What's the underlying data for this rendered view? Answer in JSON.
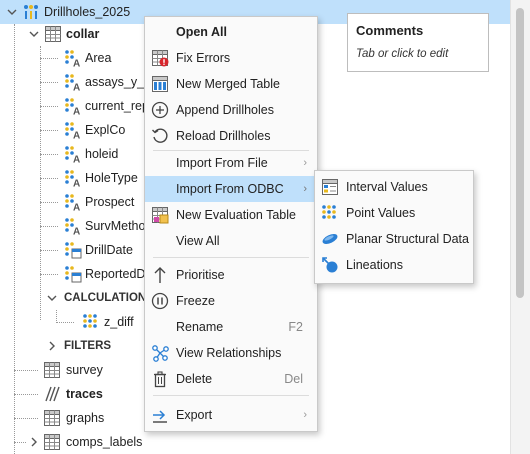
{
  "tree": {
    "root": {
      "label": "Drillholes_2025",
      "icon": "drillholes-icon"
    },
    "collar": {
      "label": "collar",
      "icon": "table-icon"
    },
    "collar_columns": [
      {
        "label": "Area",
        "icon": "text-column-icon"
      },
      {
        "label": "assays_y_n",
        "icon": "text-column-icon"
      },
      {
        "label": "current_rep",
        "icon": "text-column-icon"
      },
      {
        "label": "ExplCo",
        "icon": "text-column-icon"
      },
      {
        "label": "holeid",
        "icon": "text-column-icon"
      },
      {
        "label": "HoleType",
        "icon": "text-column-icon"
      },
      {
        "label": "Prospect",
        "icon": "text-column-icon"
      },
      {
        "label": "SurvMetho",
        "icon": "text-column-icon"
      },
      {
        "label": "DrillDate",
        "icon": "date-column-icon"
      },
      {
        "label": "ReportedDa",
        "icon": "date-column-icon"
      }
    ],
    "calculations": {
      "label": "CALCULATIONS"
    },
    "calc_column": {
      "label": "z_diff",
      "icon": "numeric-column-icon"
    },
    "filters": {
      "label": "FILTERS"
    },
    "survey": {
      "label": "survey",
      "icon": "table-icon"
    },
    "traces": {
      "label": "traces",
      "icon": "traces-icon"
    },
    "graphs": {
      "label": "graphs",
      "icon": "table-icon"
    },
    "comps_labels": {
      "label": "comps_labels",
      "icon": "table-icon"
    }
  },
  "comments": {
    "title": "Comments",
    "hint": "Tab or click to edit"
  },
  "context_menu": {
    "items": [
      {
        "label": "Open All",
        "icon": "",
        "bold": true
      },
      {
        "label": "Fix Errors",
        "icon": "fix-errors-icon"
      },
      {
        "label": "New Merged Table",
        "icon": "merged-table-icon"
      },
      {
        "label": "Append Drillholes",
        "icon": "plus-circle-icon"
      },
      {
        "label": "Reload Drillholes",
        "icon": "reload-icon"
      },
      {
        "label": "Import From File",
        "icon": "",
        "submenu": true
      },
      {
        "label": "Import From ODBC",
        "icon": "",
        "submenu": true,
        "highlighted": true
      },
      {
        "label": "New Evaluation Table",
        "icon": "evaluation-table-icon"
      },
      {
        "label": "View All",
        "icon": ""
      },
      {
        "label": "Prioritise",
        "icon": "arrow-up-icon"
      },
      {
        "label": "Freeze",
        "icon": "pause-circle-icon"
      },
      {
        "label": "Rename",
        "icon": "",
        "shortcut": "F2"
      },
      {
        "label": "View Relationships",
        "icon": "relationships-icon"
      },
      {
        "label": "Delete",
        "icon": "trash-icon",
        "shortcut": "Del"
      },
      {
        "label": "Export",
        "icon": "export-icon",
        "submenu": true
      }
    ]
  },
  "submenu": {
    "items": [
      {
        "label": "Interval Values",
        "icon": "interval-table-icon"
      },
      {
        "label": "Point Values",
        "icon": "point-values-icon"
      },
      {
        "label": "Planar Structural Data",
        "icon": "planar-structural-icon"
      },
      {
        "label": "Lineations",
        "icon": "lineations-icon"
      }
    ]
  },
  "colors": {
    "selection": "#bfe0fb",
    "accent_blue": "#2a7fd4",
    "menu_bg": "#fafafa"
  }
}
